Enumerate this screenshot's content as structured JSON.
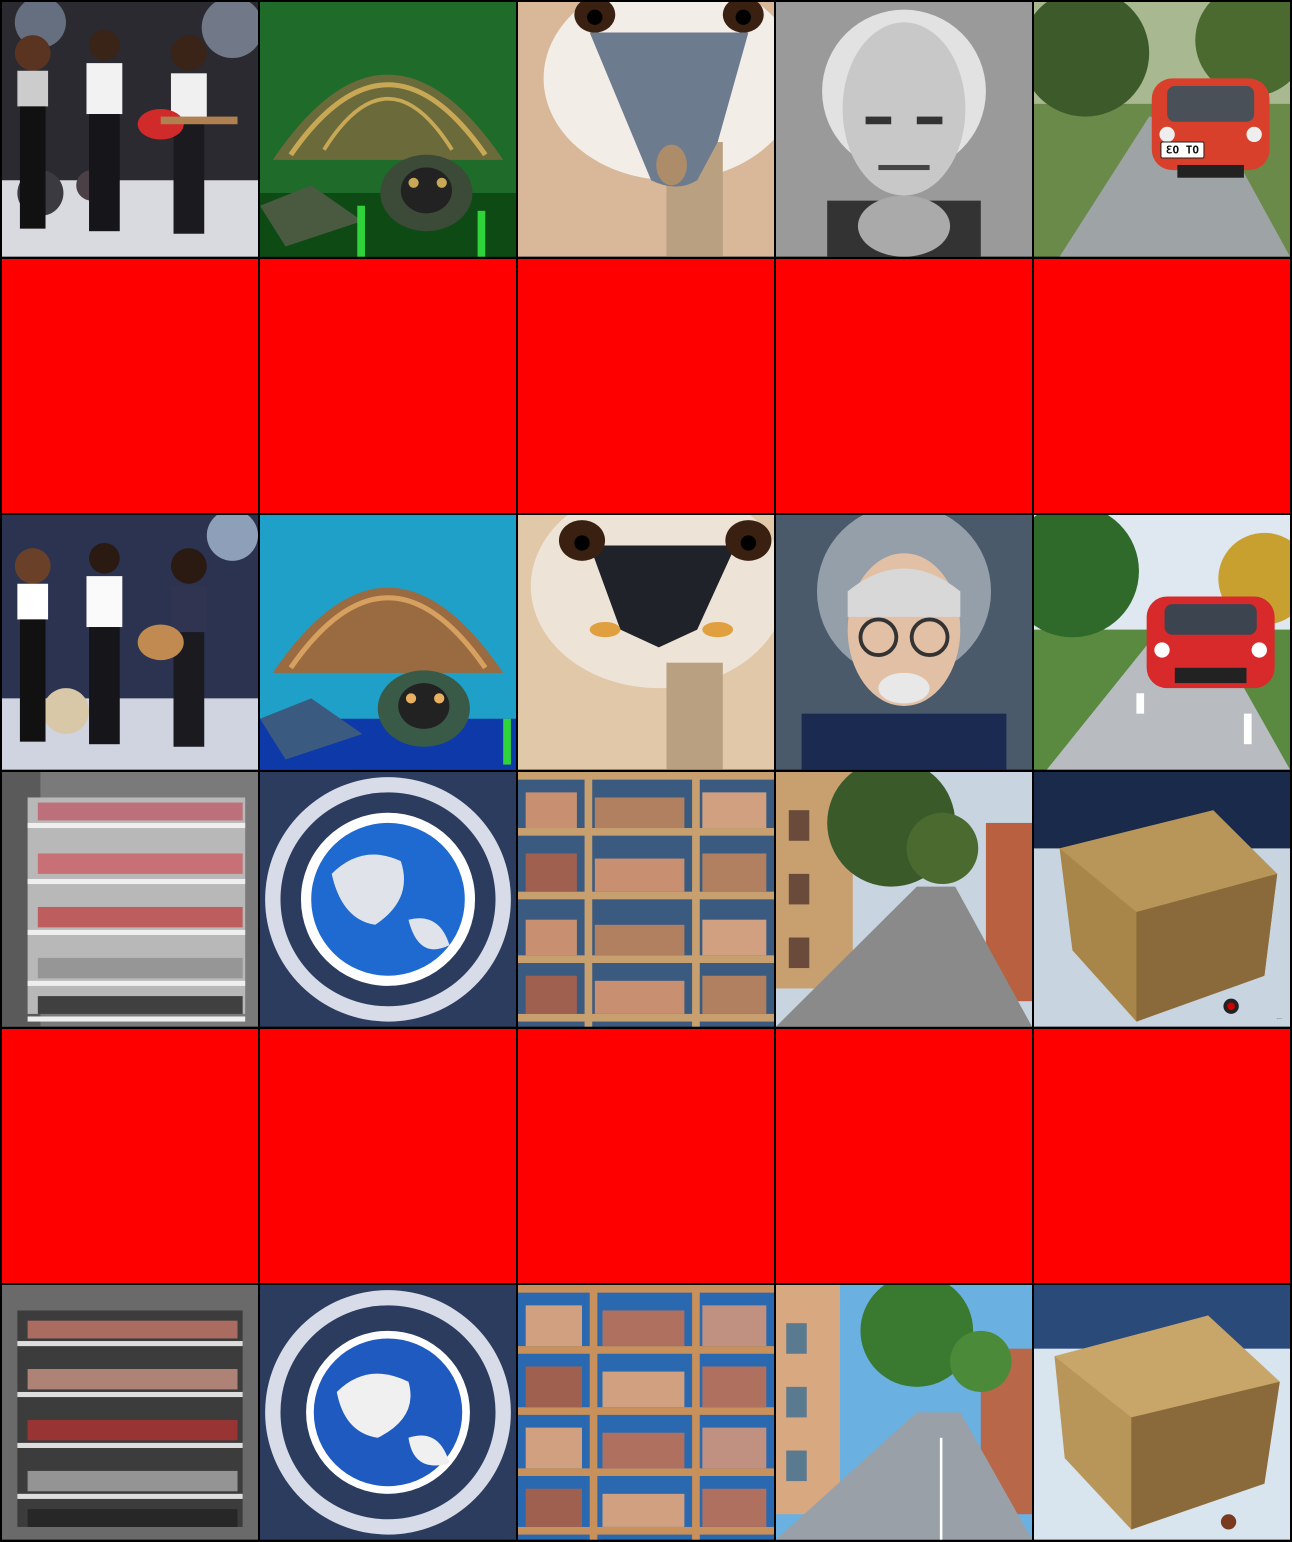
{
  "grid": {
    "columns": 5,
    "rows": 6,
    "placeholder_color": "#ff0000"
  },
  "tiles": {
    "r1": [
      "rock-band-photo",
      "tortoise-photo",
      "ostrich-photo",
      "elderly-man-bw-photo",
      "red-car-road-photo"
    ],
    "r3": [
      "rock-band-anime",
      "turtle-illustration",
      "ostrich-illustration",
      "elderly-man-illustration",
      "red-car-anime"
    ],
    "r4": [
      "shoe-rack-render",
      "earth-globe-render",
      "bookshelf-render",
      "city-street-render",
      "spiky-cube-render"
    ],
    "r6": [
      "shoe-rack-illustration",
      "earth-globe-illustration",
      "bookshelf-illustration",
      "city-street-anime",
      "spiky-cube-illustration"
    ]
  },
  "car_plate_text": "ƐO TO",
  "cube_caption_text": "..."
}
